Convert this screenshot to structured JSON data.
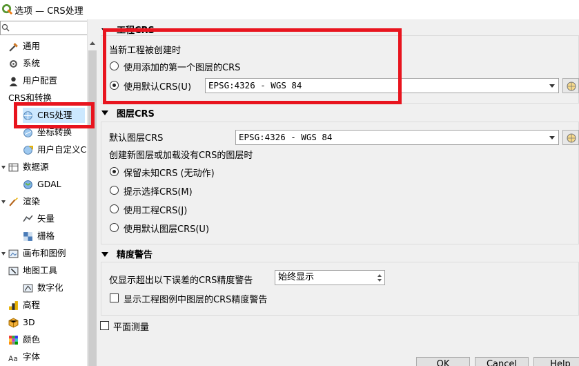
{
  "window": {
    "title": "选项 — CRS处理"
  },
  "sidebar": {
    "search_placeholder": "",
    "items": [
      {
        "label": "通用",
        "icon": "wrench-icon",
        "level": 1
      },
      {
        "label": "系统",
        "icon": "system-gear-icon",
        "level": 1
      },
      {
        "label": "用户配置",
        "icon": "user-icon",
        "level": 1
      },
      {
        "label": "CRS和转换",
        "icon": "",
        "level": 0
      },
      {
        "label": "CRS处理",
        "icon": "crs-globe-icon",
        "level": 2,
        "selected": true
      },
      {
        "label": "坐标转换",
        "icon": "transform-globe-icon",
        "level": 2
      },
      {
        "label": "用户自定义CR",
        "icon": "custom-crs-icon",
        "level": 2
      },
      {
        "label": "数据源",
        "icon": "table-icon",
        "level": 1
      },
      {
        "label": "GDAL",
        "icon": "gdal-globe-icon",
        "level": 2
      },
      {
        "label": "渲染",
        "icon": "brush-icon",
        "level": 1
      },
      {
        "label": "矢量",
        "icon": "vector-icon",
        "level": 2
      },
      {
        "label": "栅格",
        "icon": "raster-icon",
        "level": 2
      },
      {
        "label": "画布和图例",
        "icon": "canvas-icon",
        "level": 1
      },
      {
        "label": "地图工具",
        "icon": "map-tools-icon",
        "level": 1
      },
      {
        "label": "数字化",
        "icon": "digitize-icon",
        "level": 2
      },
      {
        "label": "高程",
        "icon": "elevation-icon",
        "level": 1
      },
      {
        "label": "3D",
        "icon": "cube-3d-icon",
        "level": 1
      },
      {
        "label": "颜色",
        "icon": "color-grid-icon",
        "level": 1
      },
      {
        "label": "字体",
        "icon": "font-icon",
        "level": 1
      }
    ]
  },
  "project_crs": {
    "title": "工程CRS",
    "when_created_label": "当新工程被创建时",
    "option_first_layer": "使用添加的第一个图层的CRS",
    "option_default": "使用默认CRS(U)",
    "default_crs_value": "EPSG:4326 - WGS 84"
  },
  "layer_crs": {
    "title": "图层CRS",
    "default_layer_crs_label": "默认图层CRS",
    "default_layer_crs_value": "EPSG:4326 - WGS 84",
    "create_new_label": "创建新图层或加载没有CRS的图层时",
    "options": [
      {
        "label": "保留未知CRS (无动作)",
        "checked": true
      },
      {
        "label": "提示选择CRS(M)",
        "checked": false
      },
      {
        "label": "使用工程CRS(J)",
        "checked": false
      },
      {
        "label": "使用默认图层CRS(U)",
        "checked": false
      }
    ]
  },
  "accuracy": {
    "title": "精度警告",
    "threshold_label": "仅显示超出以下误差的CRS精度警告",
    "threshold_value": "始终显示",
    "legend_checkbox_label": "显示工程图例中图层的CRS精度警告"
  },
  "planimetric": {
    "label": "平面测量"
  },
  "buttons": {
    "ok": "OK",
    "cancel": "Cancel",
    "help": "Help"
  },
  "colors": {
    "annotation_red": "#e8141e",
    "selection": "#cce8ff"
  }
}
